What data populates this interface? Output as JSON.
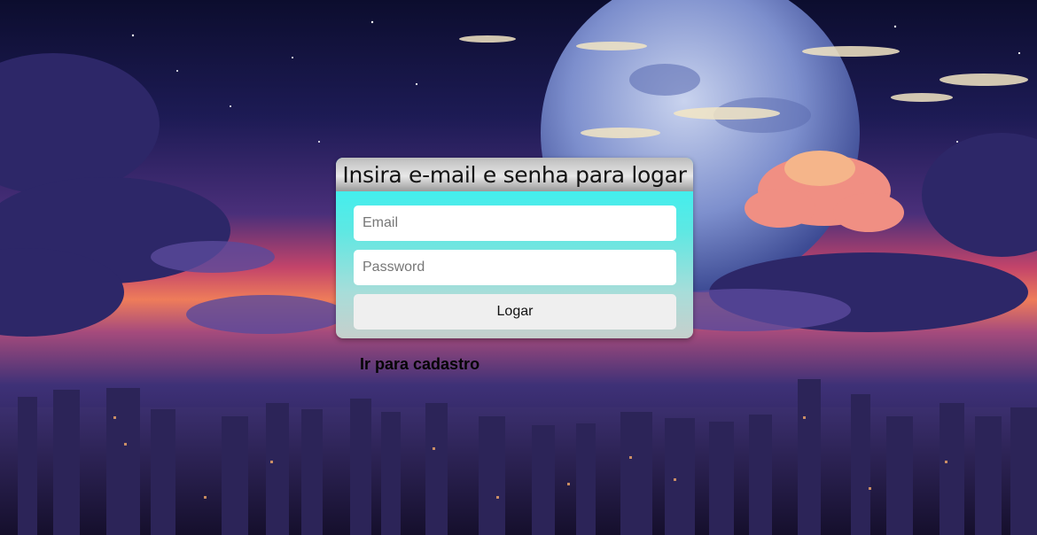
{
  "login": {
    "title": "Insira e-mail e senha para logar",
    "email_placeholder": "Email",
    "password_placeholder": "Password",
    "submit_label": "Logar"
  },
  "register_link": "Ir para cadastro",
  "colors": {
    "card_top": "#2ef4f6",
    "card_bottom": "#c6cfcc",
    "header_bar": "#d6d6d6",
    "button": "#efefef",
    "sky_top": "#0c0d2e",
    "sunset_glow": "#e3566a"
  }
}
